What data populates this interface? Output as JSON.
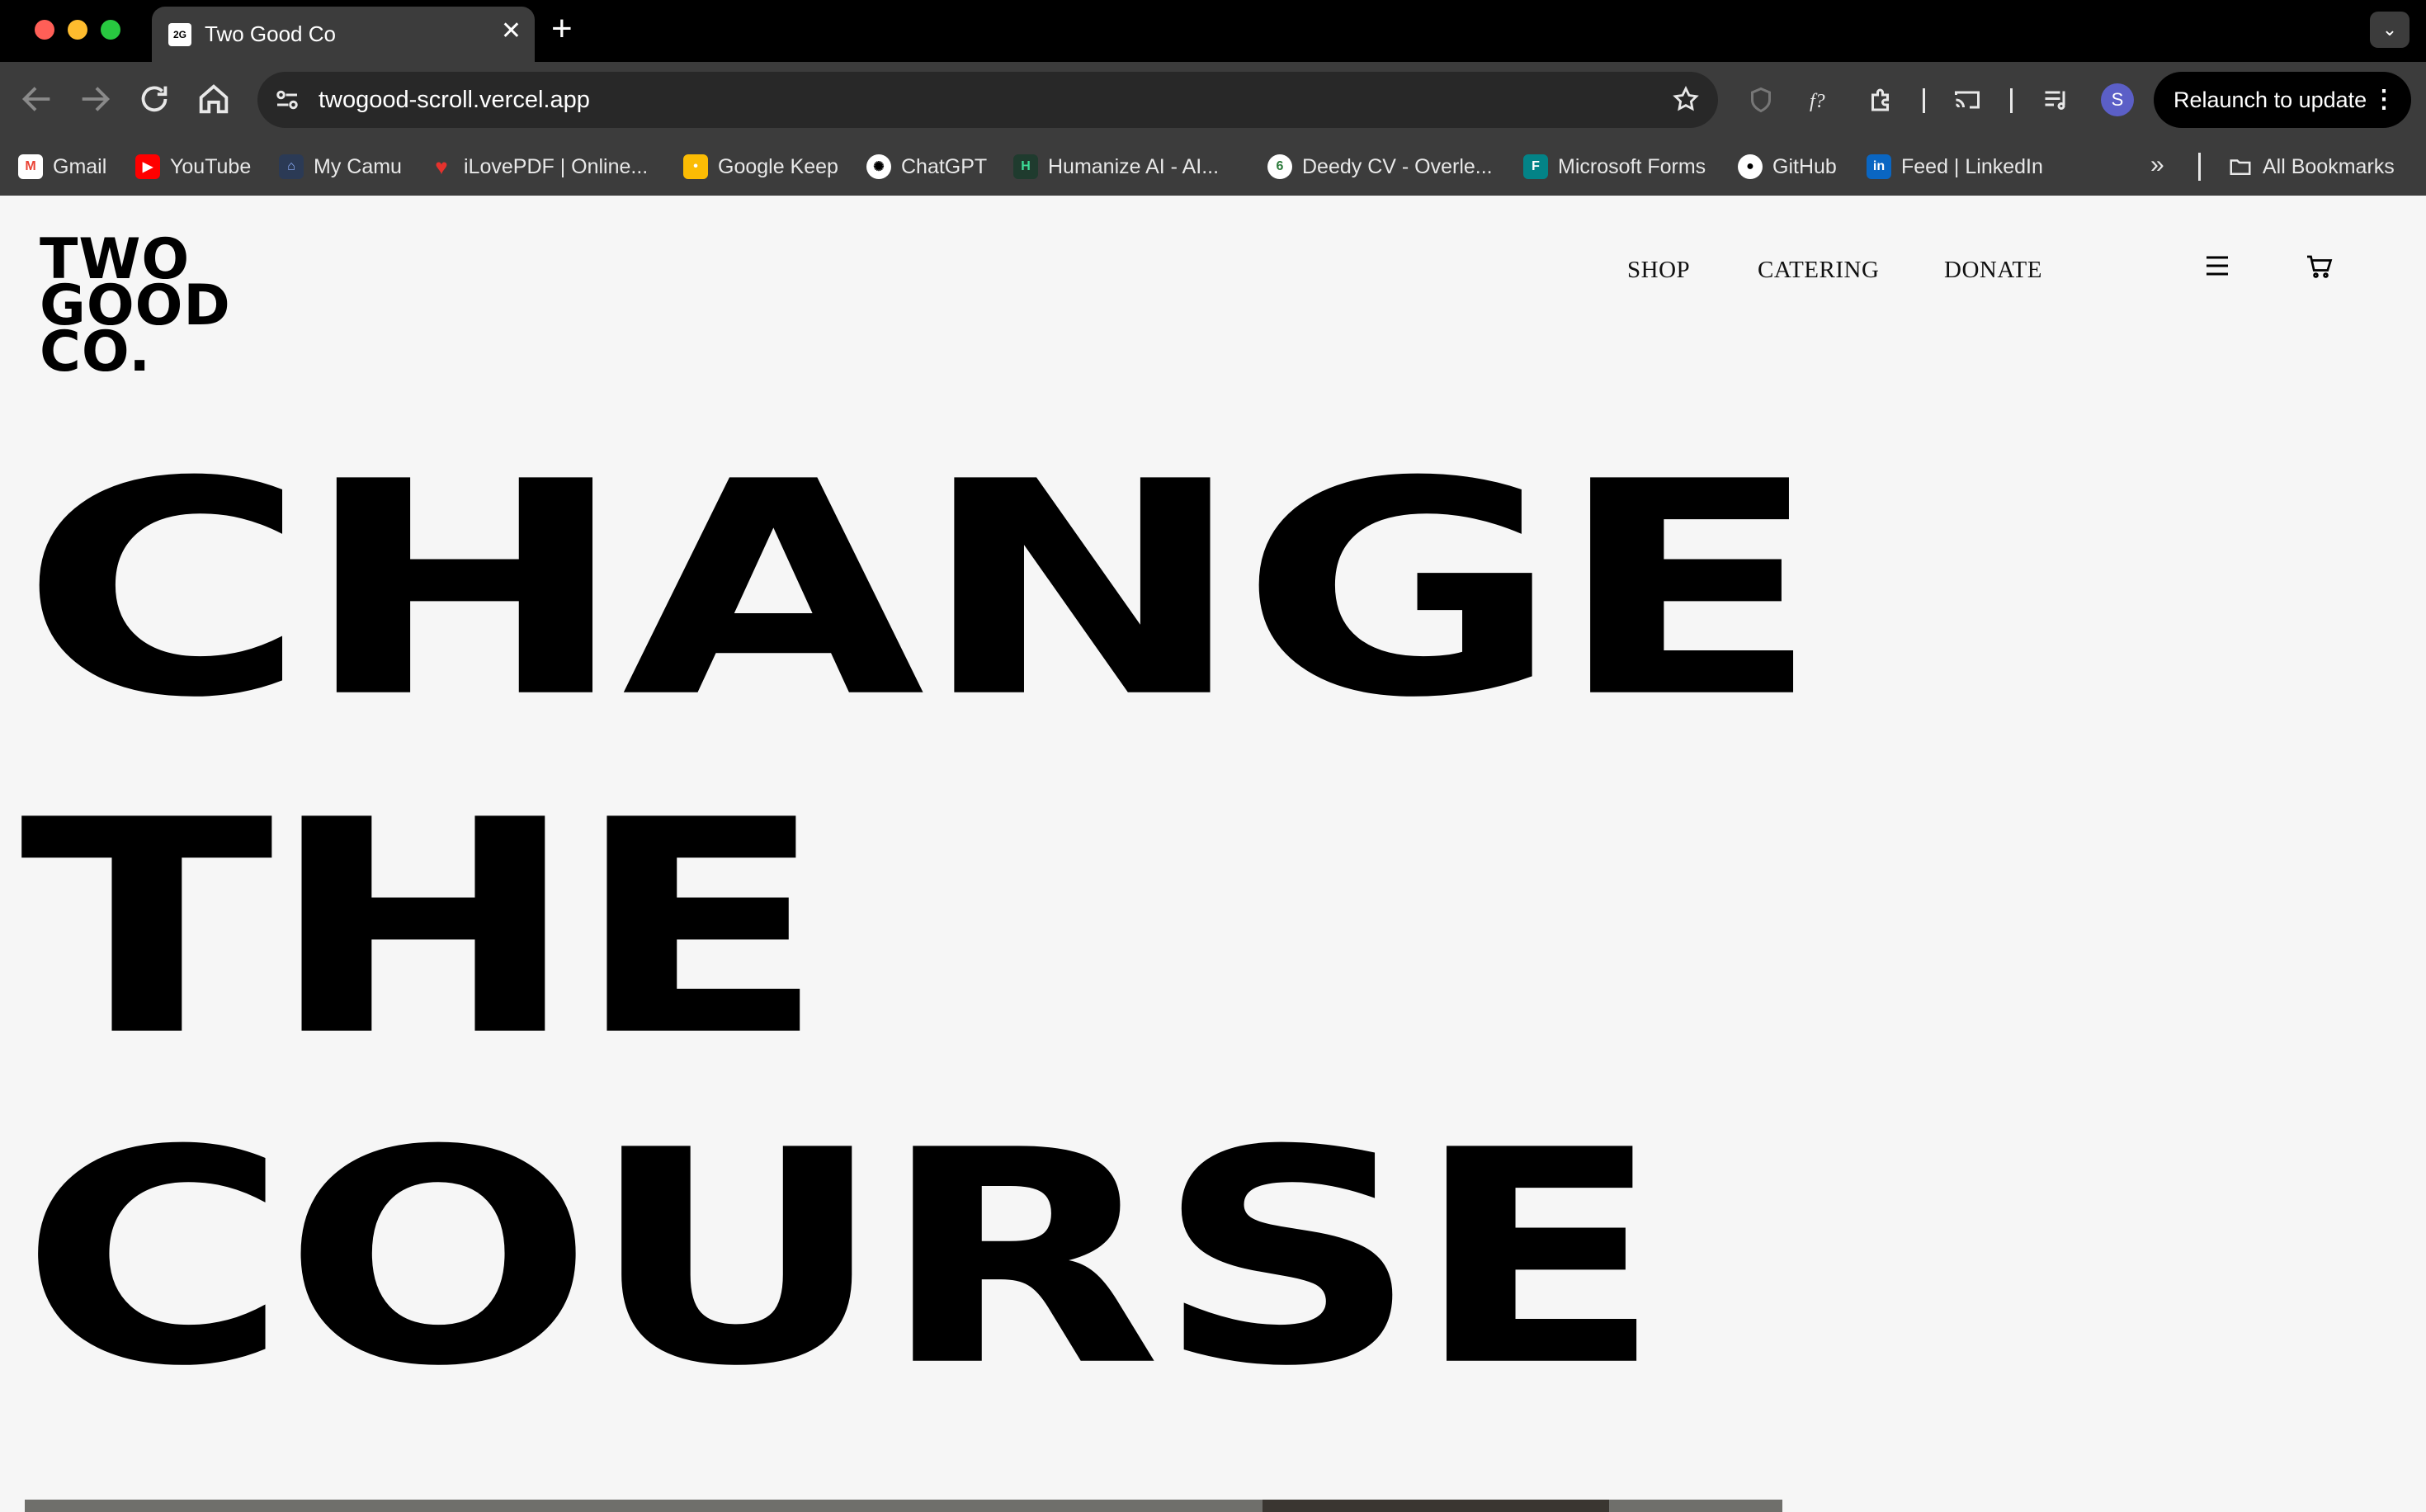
{
  "browser": {
    "tab": {
      "title": "Two Good Co"
    },
    "url": "twogood-scroll.vercel.app",
    "profile_initial": "S",
    "relaunch_label": "Relaunch to update",
    "bookmarks": [
      {
        "label": "Gmail",
        "icon": "gmail-icon",
        "color": "#ea4335"
      },
      {
        "label": "YouTube",
        "icon": "youtube-icon",
        "color": "#ff0000"
      },
      {
        "label": "My Camu",
        "icon": "camu-icon",
        "color": "#4a7bd0"
      },
      {
        "label": "iLovePDF | Online...",
        "icon": "ilovepdf-icon",
        "color": "#e5322d"
      },
      {
        "label": "Google Keep",
        "icon": "keep-icon",
        "color": "#fbbc04"
      },
      {
        "label": "ChatGPT",
        "icon": "chatgpt-icon",
        "color": "#ffffff"
      },
      {
        "label": "Humanize AI - AI...",
        "icon": "humanize-icon",
        "color": "#3ddc97"
      },
      {
        "label": "Deedy CV - Overle...",
        "icon": "overleaf-icon",
        "color": "#ffffff"
      },
      {
        "label": "Microsoft Forms",
        "icon": "forms-icon",
        "color": "#038387"
      },
      {
        "label": "GitHub",
        "icon": "github-icon",
        "color": "#ffffff"
      },
      {
        "label": "Feed | LinkedIn",
        "icon": "linkedin-icon",
        "color": "#0a66c2"
      }
    ],
    "all_bookmarks": "All Bookmarks"
  },
  "site": {
    "logo_lines": [
      "TWO",
      "GOOD",
      "CO."
    ],
    "nav": [
      "SHOP",
      "CATERING",
      "DONATE"
    ],
    "hero": [
      "CHANGE",
      "THE",
      "COURSE"
    ],
    "background": "#f6f6f6"
  }
}
